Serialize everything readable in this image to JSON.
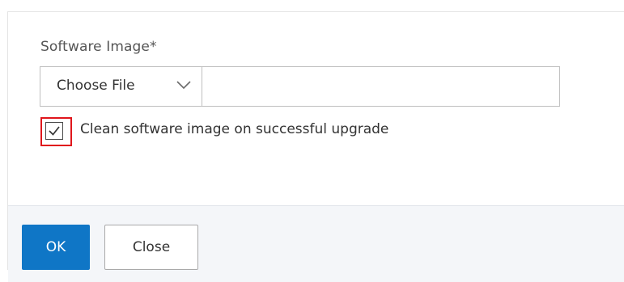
{
  "form": {
    "software_image_label": "Software Image*",
    "choose_file_label": "Choose File",
    "file_name": "",
    "clean_image_label": "Clean software image on successful upgrade",
    "clean_image_checked": true
  },
  "footer": {
    "ok_label": "OK",
    "close_label": "Close"
  },
  "icons": {
    "dropdown": "chevron-down-icon",
    "checkmark": "checkmark-icon"
  },
  "colors": {
    "primary_button": "#0f76c6",
    "highlight_border": "#e0161c",
    "footer_background": "#f4f6f9"
  }
}
